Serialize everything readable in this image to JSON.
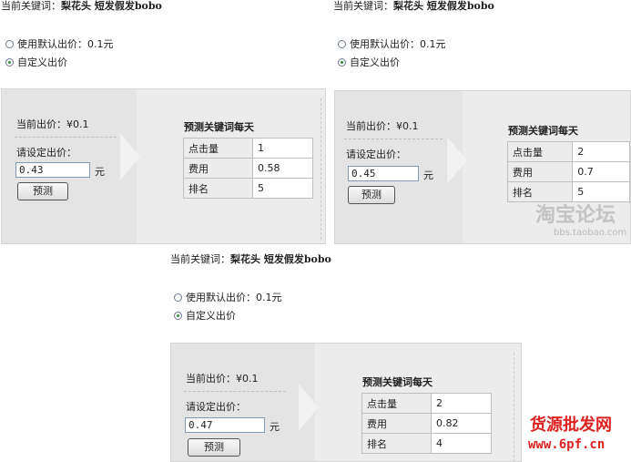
{
  "panels": [
    {
      "keyword_label": "当前关键词：",
      "keyword_value": "梨花头 短发假发bobo",
      "option_default": "使用默认出价：0.1元",
      "option_custom": "自定义出价",
      "current_bid_label": "当前出价：",
      "current_bid_value": "¥0.1",
      "set_bid_label": "请设定出价：",
      "bid_input_value": "0.43",
      "yuan_label": "元",
      "predict_button": "预测",
      "forecast_title": "预测关键词每天",
      "rows": [
        {
          "key": "点击量",
          "value": "1"
        },
        {
          "key": "费用",
          "value": "0.58"
        },
        {
          "key": "排名",
          "value": "5"
        }
      ]
    },
    {
      "keyword_label": "当前关键词：",
      "keyword_value": "梨花头 短发假发bobo",
      "option_default": "使用默认出价：0.1元",
      "option_custom": "自定义出价",
      "current_bid_label": "当前出价：",
      "current_bid_value": "¥0.1",
      "set_bid_label": "请设定出价：",
      "bid_input_value": "0.45",
      "yuan_label": "元",
      "predict_button": "预测",
      "forecast_title": "预测关键词每天",
      "rows": [
        {
          "key": "点击量",
          "value": "2"
        },
        {
          "key": "费用",
          "value": "0.7"
        },
        {
          "key": "排名",
          "value": "5"
        }
      ]
    },
    {
      "keyword_label": "当前关键词：",
      "keyword_value": "梨花头 短发假发bobo",
      "option_default": "使用默认出价：0.1元",
      "option_custom": "自定义出价",
      "current_bid_label": "当前出价：",
      "current_bid_value": "¥0.1",
      "set_bid_label": "请设定出价：",
      "bid_input_value": "0.47",
      "yuan_label": "元",
      "predict_button": "预测",
      "forecast_title": "预测关键词每天",
      "rows": [
        {
          "key": "点击量",
          "value": "2"
        },
        {
          "key": "费用",
          "value": "0.82"
        },
        {
          "key": "排名",
          "value": "4"
        }
      ]
    }
  ],
  "watermarks": {
    "taobao": "淘宝论坛",
    "taobao_url": "bbs.taobao.com",
    "source": "货源批发网",
    "source_url": "www.6pf.cn"
  }
}
